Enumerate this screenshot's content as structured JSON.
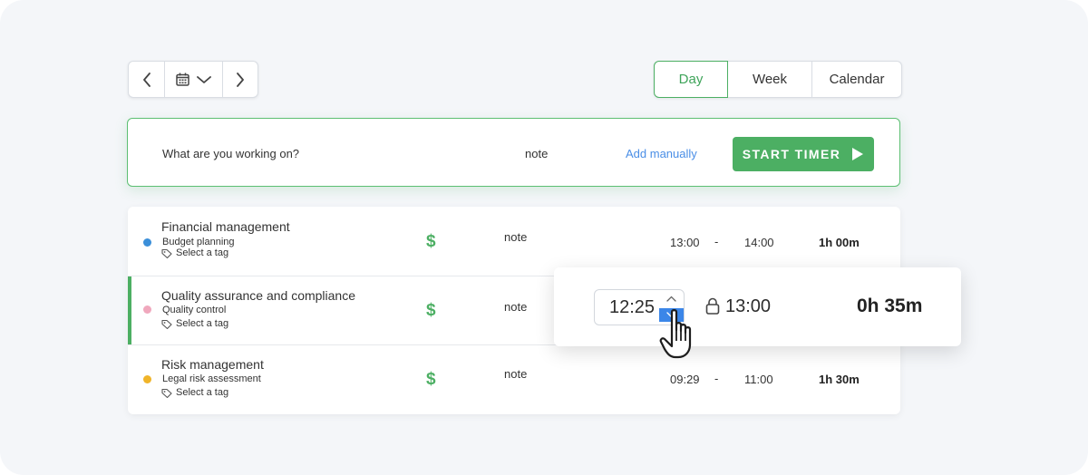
{
  "date_nav": {
    "prev_icon": "chevron-left-icon",
    "calendar_icon": "calendar-icon",
    "dropdown_icon": "chevron-down-icon",
    "next_icon": "chevron-right-icon"
  },
  "view_switch": {
    "tabs": [
      {
        "label": "Day",
        "active": true
      },
      {
        "label": "Week",
        "active": false
      },
      {
        "label": "Calendar",
        "active": false
      }
    ]
  },
  "timer": {
    "prompt": "What are you working on?",
    "note": "note",
    "add_manually": "Add manually",
    "start_label": "START TIMER",
    "start_icon": "play-icon"
  },
  "entries": [
    {
      "title": "Financial management",
      "subtitle": "Budget planning",
      "tag": "Select a tag",
      "dot_color": "#3b8fd9",
      "billable": "$",
      "note": "note",
      "start": "13:00",
      "dash": "-",
      "end": "14:00",
      "duration": "1h 00m"
    },
    {
      "title": "Quality assurance and compliance",
      "subtitle": "Quality control",
      "tag": "Select a tag",
      "dot_color": "#f0a8bd",
      "billable": "$",
      "note": "note"
    },
    {
      "title": "Risk management",
      "subtitle": "Legal risk assessment",
      "tag": "Select a tag",
      "dot_color": "#f0b429",
      "billable": "$",
      "note": "note",
      "start": "09:29",
      "dash": "-",
      "end": "11:00",
      "duration": "1h 30m"
    }
  ],
  "edit_popover": {
    "start_value": "12:25",
    "end_value": "13:00",
    "duration": "0h 35m",
    "lock_icon": "lock-icon"
  },
  "colors": {
    "accent_green": "#4caf63",
    "link_blue": "#4a8ee6",
    "spinner_blue": "#3b86e8"
  }
}
